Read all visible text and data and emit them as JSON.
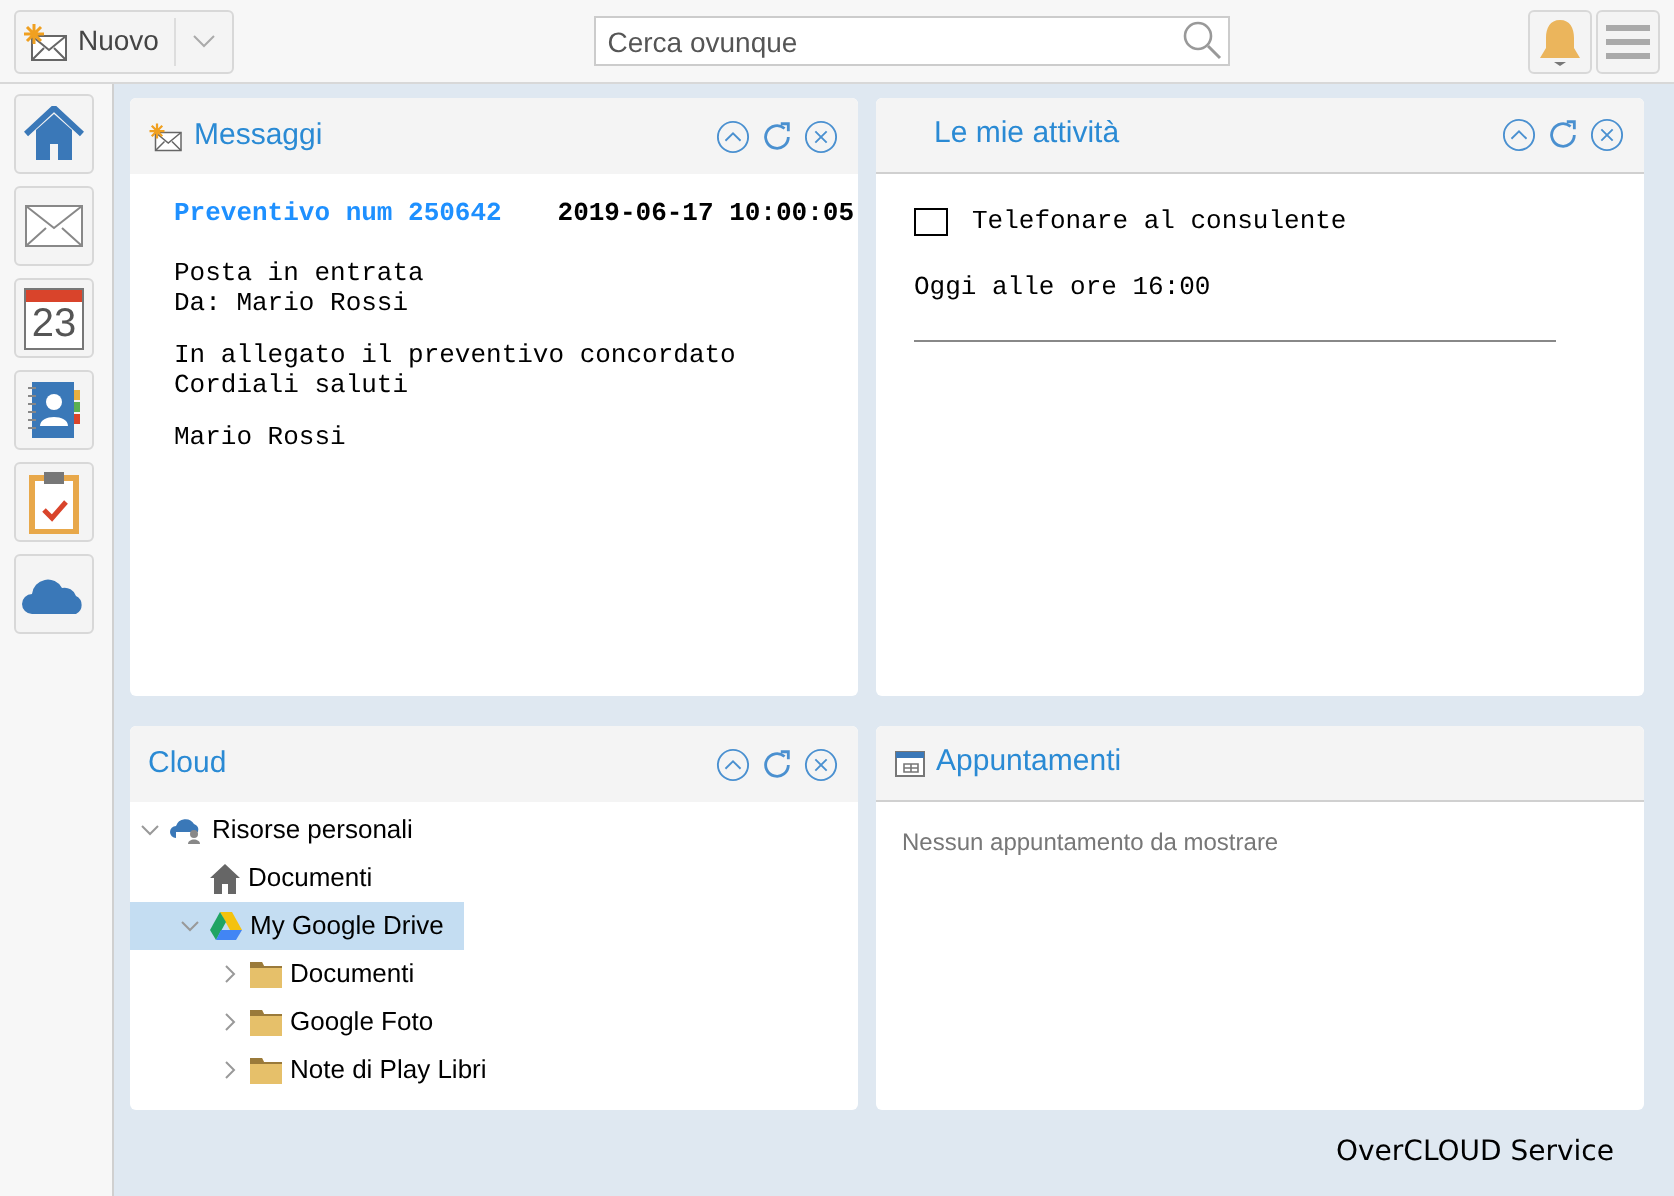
{
  "toolbar": {
    "new_button": "Nuovo",
    "search": {
      "placeholder": "Cerca ovunque"
    }
  },
  "sidebar": {
    "items": [
      {
        "kind": "home"
      },
      {
        "kind": "mail"
      },
      {
        "kind": "calendar",
        "day": "23"
      },
      {
        "kind": "contacts"
      },
      {
        "kind": "tasks"
      },
      {
        "kind": "cloud"
      }
    ]
  },
  "messages": {
    "title": "Messaggi",
    "subject": "Preventivo num 250642",
    "date": "2019-06-17 10:00:05",
    "lines": [
      [
        "Posta in entrata",
        "Da: Mario Rossi"
      ],
      [
        "In allegato il preventivo concordato",
        "Cordiali saluti"
      ],
      [
        "Mario Rossi"
      ]
    ]
  },
  "activities": {
    "title": "Le mie attività",
    "tasks": [
      {
        "label": "Telefonare al consulente",
        "checked": false,
        "when": "Oggi alle ore 16:00"
      }
    ]
  },
  "cloud": {
    "title": "Cloud",
    "tree": [
      {
        "label": "Risorse personali",
        "kind": "personal",
        "expanded": true,
        "selected": false,
        "children": [
          {
            "label": "Documenti",
            "kind": "home",
            "selected": false
          },
          {
            "label": "My Google Drive",
            "kind": "drive",
            "expanded": true,
            "selected": true,
            "children": [
              {
                "label": "Documenti",
                "kind": "folder",
                "expanded": false,
                "selected": false
              },
              {
                "label": "Google Foto",
                "kind": "folder",
                "expanded": false,
                "selected": false
              },
              {
                "label": "Note di Play Libri",
                "kind": "folder",
                "expanded": false,
                "selected": false
              }
            ]
          }
        ]
      }
    ]
  },
  "appointments": {
    "title": "Appuntamenti",
    "empty": "Nessun appuntamento da mostrare"
  },
  "footer": "OverCLOUD Service"
}
